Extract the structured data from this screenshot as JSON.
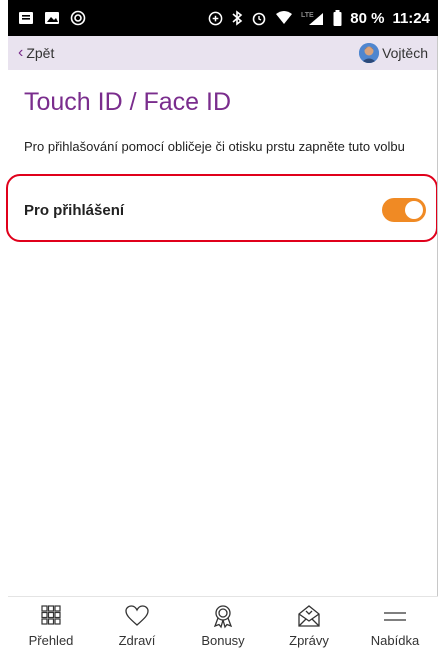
{
  "status_bar": {
    "battery": "80 %",
    "time": "11:24",
    "network": "LTE",
    "icons_left": [
      "notification-icon",
      "image-icon",
      "target-icon"
    ],
    "icons_right": [
      "data-saver-icon",
      "bluetooth-icon",
      "alarm-icon",
      "wifi-icon",
      "signal-icon",
      "battery-icon"
    ]
  },
  "nav": {
    "back_label": "Zpět",
    "user_name": "Vojtěch"
  },
  "page": {
    "title": "Touch ID / Face ID",
    "description": "Pro přihlašování pomocí obličeje či otisku prstu zapněte tuto volbu"
  },
  "setting": {
    "label": "Pro přihlášení",
    "enabled": true
  },
  "colors": {
    "accent": "#7a2d8d",
    "toggle_on": "#f08a24",
    "highlight": "#e0001b",
    "nav_bg": "#e9e3ef"
  },
  "tabs": [
    {
      "label": "Přehled",
      "icon": "grid-icon"
    },
    {
      "label": "Zdraví",
      "icon": "heart-icon"
    },
    {
      "label": "Bonusy",
      "icon": "award-icon"
    },
    {
      "label": "Zprávy",
      "icon": "envelope-icon"
    },
    {
      "label": "Nabídka",
      "icon": "menu-icon"
    }
  ]
}
